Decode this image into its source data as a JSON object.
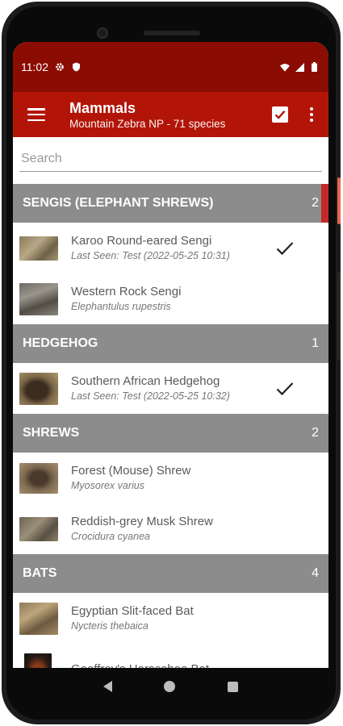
{
  "status_bar": {
    "time": "11:02"
  },
  "app_bar": {
    "title": "Mammals",
    "subtitle": "Mountain Zebra NP - 71 species"
  },
  "search": {
    "placeholder": "Search",
    "value": ""
  },
  "sections": [
    {
      "name": "SENGIS (ELEPHANT SHREWS)",
      "count": "2",
      "items": [
        {
          "name": "Karoo Round-eared Sengi",
          "sub": "Last Seen: Test (2022-05-25 10:31)",
          "seen": true
        },
        {
          "name": "Western Rock Sengi",
          "sub": "Elephantulus rupestris",
          "seen": false
        }
      ]
    },
    {
      "name": "HEDGEHOG",
      "count": "1",
      "items": [
        {
          "name": "Southern African Hedgehog",
          "sub": "Last Seen: Test (2022-05-25 10:32)",
          "seen": true
        }
      ]
    },
    {
      "name": "SHREWS",
      "count": "2",
      "items": [
        {
          "name": "Forest (Mouse) Shrew",
          "sub": "Myosorex varius",
          "seen": false
        },
        {
          "name": "Reddish-grey Musk Shrew",
          "sub": "Crocidura cyanea",
          "seen": false
        }
      ]
    },
    {
      "name": "BATS",
      "count": "4",
      "items": [
        {
          "name": "Egyptian Slit-faced Bat",
          "sub": "Nycteris thebaica",
          "seen": false
        },
        {
          "name": "Geoffroy's Horseshoe Bat",
          "sub": "",
          "seen": false
        }
      ]
    }
  ],
  "colors": {
    "status_bar": "#8b0c02",
    "app_bar": "#b21507",
    "section_header": "#8c8c8c",
    "scroll_accent": "#c62828"
  }
}
